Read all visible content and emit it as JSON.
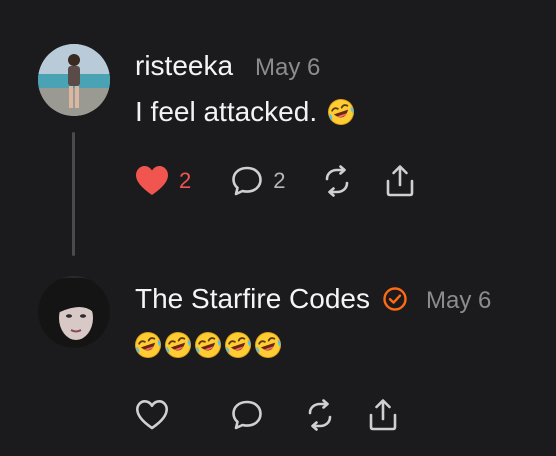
{
  "comments": [
    {
      "username": "risteeka",
      "date": "May 6",
      "text": "I feel attacked.",
      "emoji": "🤣",
      "likes": "2",
      "replies": "2",
      "liked": true
    },
    {
      "username": "The Starfire Codes",
      "date": "May 6",
      "verified": true,
      "emoji_count": 5,
      "liked": false
    }
  ],
  "colors": {
    "background": "#1b1b1d",
    "like_active": "#f0554f",
    "verified_badge": "#ff6a13",
    "muted_text": "#8c8c90"
  },
  "icons": [
    "heart-icon",
    "comment-icon",
    "repost-icon",
    "share-icon",
    "verified-badge-icon",
    "laughing-emoji"
  ]
}
